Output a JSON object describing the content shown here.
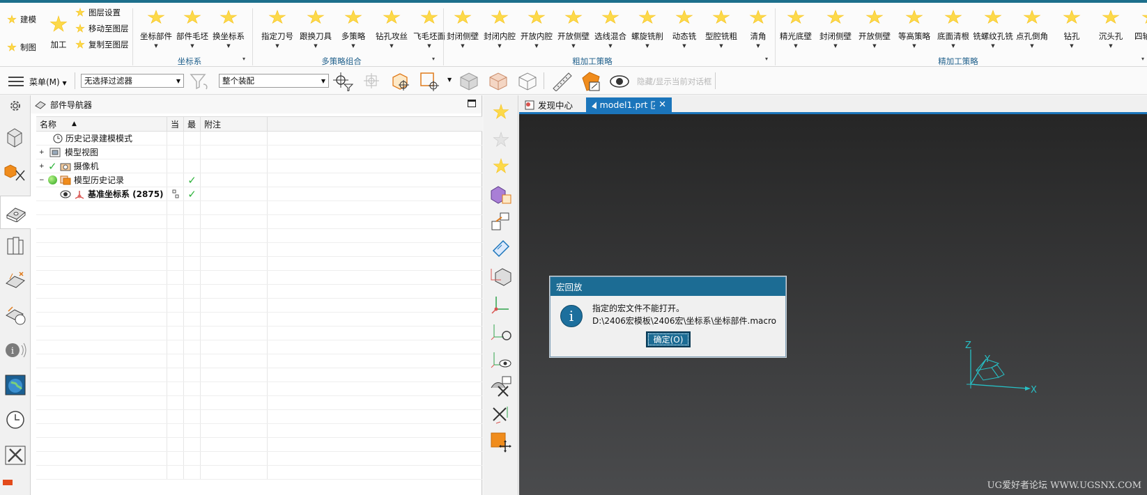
{
  "ribbon": {
    "quick": {
      "build": "建模",
      "draw": "制图",
      "machining": "加工",
      "layer_settings": "图层设置",
      "move_to_layer": "移动至图层",
      "copy_to_layer": "复制至图层"
    },
    "groups": [
      {
        "label": "坐标系",
        "items": [
          "坐标部件",
          "部件毛坯",
          "换坐标系"
        ]
      },
      {
        "label": "多策略组合",
        "items": [
          "指定刀号",
          "跟换刀具",
          "多策略",
          "钻孔攻丝",
          "飞毛坯面"
        ]
      },
      {
        "label": "粗加工策略",
        "items": [
          "封闭侧壁",
          "封闭内腔",
          "开放内腔",
          "开放侧壁",
          "选线混合",
          "螺旋铣削",
          "动态铣",
          "型腔铣粗",
          "清角"
        ]
      },
      {
        "label": "精加工策略",
        "items": [
          "精光底壁",
          "封闭侧壁",
          "开放侧壁",
          "等高策略",
          "底面清根",
          "铣螺纹孔铣",
          "点孔倒角",
          "钻孔",
          "沉头孔",
          "四轴策略"
        ]
      }
    ]
  },
  "toolbar": {
    "menu_label": "菜单(M)",
    "filter_value": "无选择过滤器",
    "assembly_value": "整个装配",
    "hide_show_label": "隐藏/显示当前对话框"
  },
  "navigator": {
    "title": "部件导航器",
    "columns": [
      "名称",
      "当",
      "最",
      "附注"
    ],
    "rows": [
      {
        "name": "历史记录建模模式",
        "cur": "",
        "last": ""
      },
      {
        "name": "模型视图",
        "cur": "",
        "last": ""
      },
      {
        "name": "摄像机",
        "cur": "",
        "last": ""
      },
      {
        "name": "模型历史记录",
        "cur": "",
        "last": "✓"
      },
      {
        "name": "基准坐标系 (2875)",
        "cur": "",
        "last": "✓"
      }
    ]
  },
  "tabs": [
    {
      "label": "发现中心"
    },
    {
      "label": "model1.prt"
    }
  ],
  "dialog": {
    "title": "宏回放",
    "message": "指定的宏文件不能打开。",
    "path": "D:\\2406宏模板\\2406宏\\坐标系\\坐标部件.macro",
    "ok_label": "确定(O)"
  },
  "axes": {
    "x": "X",
    "y": "Y",
    "z": "Z"
  },
  "watermark": "UG爱好者论坛 WWW.UGSNX.COM",
  "colors": {
    "accent": "#1b75bb",
    "dialog_title": "#1c6c94",
    "star": "#f7c21b",
    "check": "#2fb33c"
  }
}
